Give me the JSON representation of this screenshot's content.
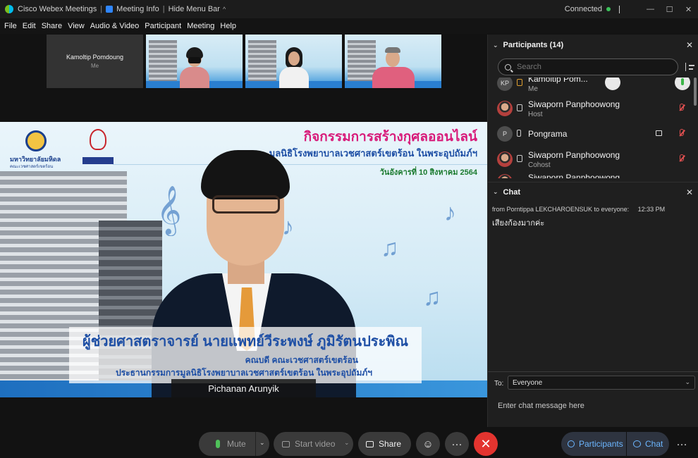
{
  "titlebar": {
    "app_name": "Cisco Webex Meetings",
    "separator": "|",
    "meeting_info": "Meeting Info",
    "hide_menu": "Hide Menu Bar",
    "hide_menu_chevron": "^",
    "status": "Connected",
    "minimize": "—",
    "maximize": "☐",
    "close": "✕"
  },
  "menu": [
    "File",
    "Edit",
    "Share",
    "View",
    "Audio & Video",
    "Participant",
    "Meeting",
    "Help"
  ],
  "thumbnails": {
    "me_name": "Kamoltip Pomdoung",
    "me_label": "Me"
  },
  "stage": {
    "logo_a_text": "มหาวิทยาลัยมหิดล",
    "logo_a_sub": "คณะเวชศาสตร์เขตร้อน",
    "title1": "กิจกรรมการสร้างกุศลออนไลน์",
    "title2": "มูลนิธิโรงพยาบาลเวชศาสตร์เขตร้อน ในพระอุปถัมภ์ฯ",
    "title3": "วันอังคารที่ 10 สิงหาคม 2564",
    "caption_name": "ผู้ช่วยศาสตราจารย์ นายแพทย์วีระพงษ์ ภูมิรัตนประพิณ",
    "caption_role1": "คณบดี คณะเวชศาสตร์เขตร้อน",
    "caption_role2": "ประธานกรรมการมูลนิธิโรงพยาบาลเวชศาสตร์เขตร้อน ในพระอุปถัมภ์ฯ",
    "active_speaker": "Pichanan Arunyik"
  },
  "participants": {
    "header": "Participants (14)",
    "chevron": "⌄",
    "close": "✕",
    "search_placeholder": "Search",
    "list": [
      {
        "initials": "KP",
        "name": "Kamoltip Pom...",
        "role": "Me"
      },
      {
        "initials": "",
        "name": "Siwaporn Panphoowong",
        "role": "Host"
      },
      {
        "initials": "P",
        "name": "Pongrama",
        "role": ""
      },
      {
        "initials": "",
        "name": "Siwaporn Panphoowong",
        "role": "Cohost"
      },
      {
        "initials": "",
        "name": "Siwaporn Panphoowong",
        "role": ""
      }
    ]
  },
  "chat": {
    "header": "Chat",
    "chevron": "⌄",
    "close": "✕",
    "from": "from Porntippa LEKCHAROENSUK to everyone:",
    "time": "12:33 PM",
    "message": "เสียงก้องมากค่ะ",
    "to_label": "To:",
    "to_value": "Everyone",
    "to_dropdown": "⌄",
    "input_placeholder": "Enter chat message here"
  },
  "controls": {
    "mute": "Mute",
    "start_video": "Start video",
    "share": "Share",
    "dropdown": "⌄",
    "reactions_icon": "☺",
    "more_icon": "···",
    "end_icon": "✕",
    "participants": "Participants",
    "chat": "Chat"
  },
  "colors": {
    "connected": "#3cc25a",
    "end_button": "#e3342f",
    "panel_accent": "#6cb6ff",
    "mute_mic": "#4fc15a"
  }
}
